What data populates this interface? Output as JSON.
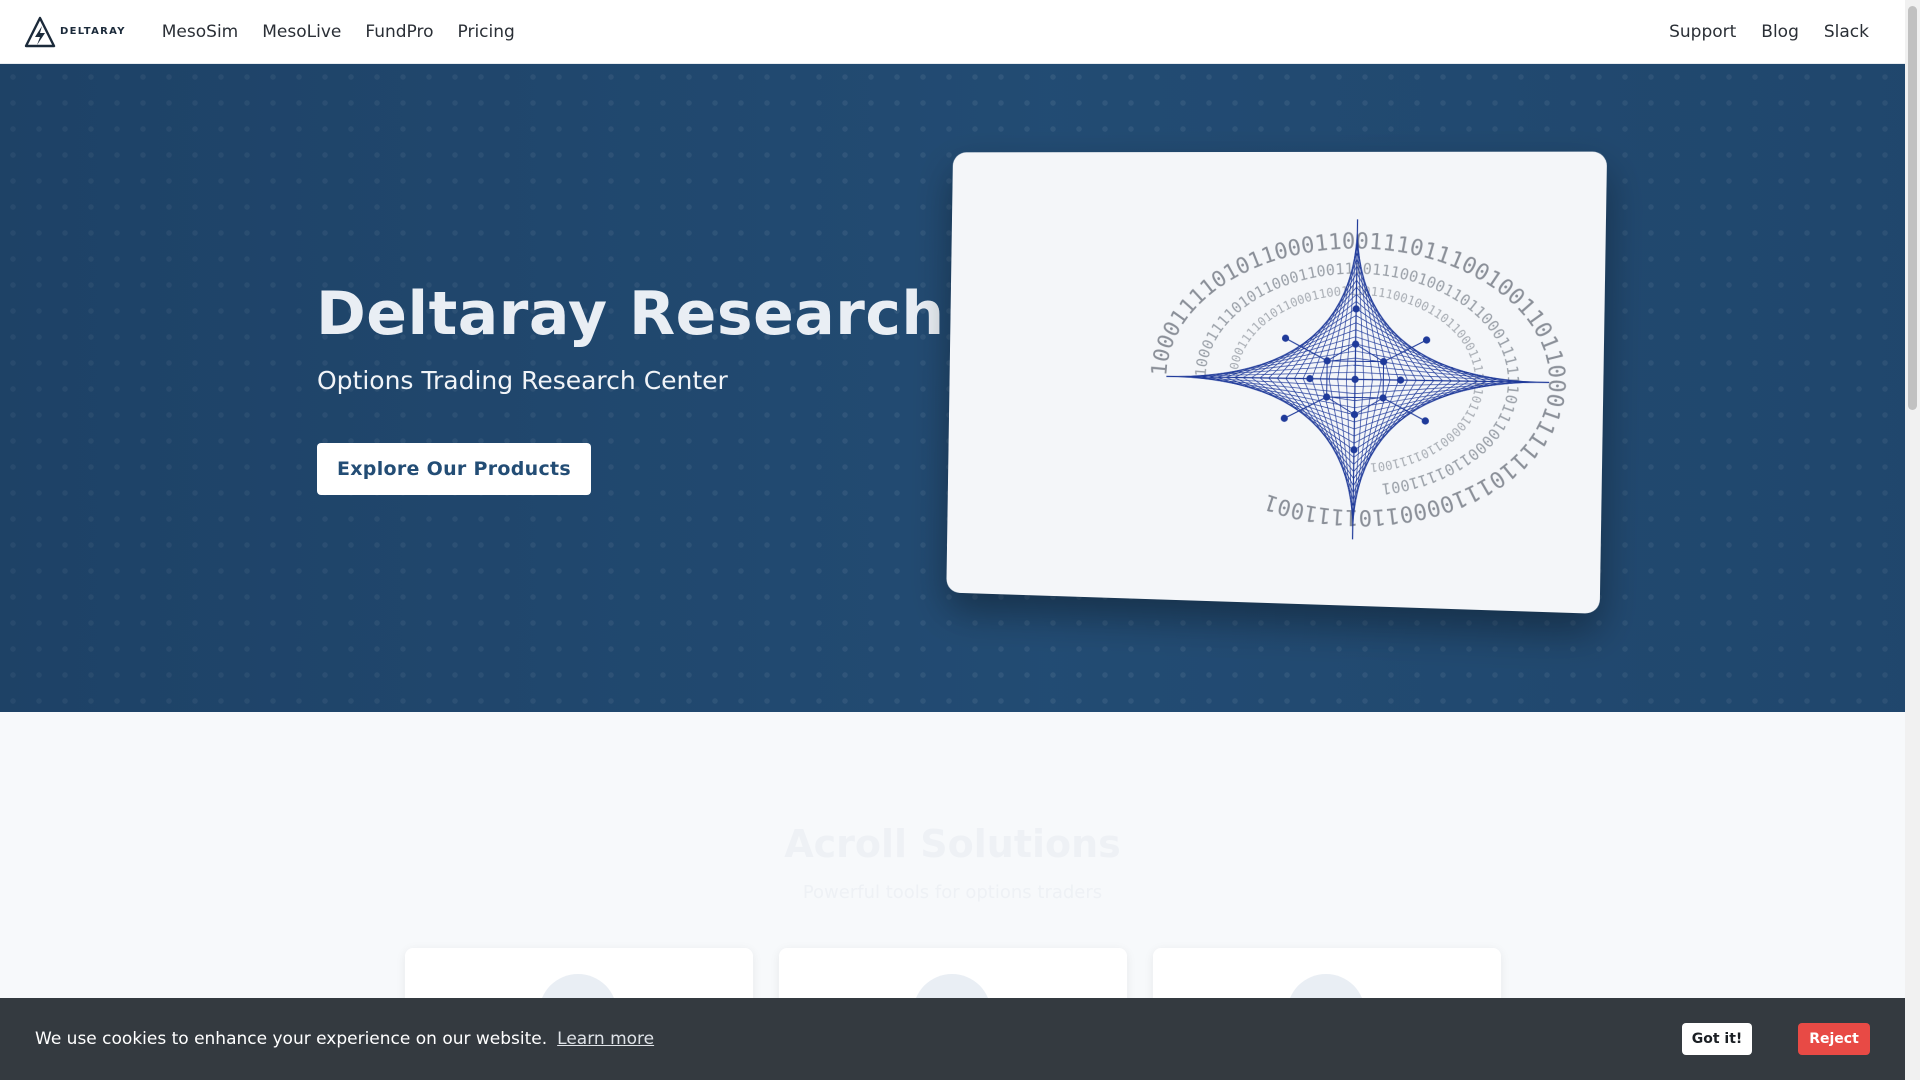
{
  "brand": {
    "name": "DELTARAY"
  },
  "nav": {
    "left": [
      "MesoSim",
      "MesoLive",
      "FundPro",
      "Pricing"
    ],
    "right": [
      "Support",
      "Blog",
      "Slack"
    ]
  },
  "hero": {
    "title": "Deltaray Research",
    "subtitle": "Options Trading Research Center",
    "cta": "Explore Our Products",
    "card_binary_text": "1000111101011000110011101110010011011000111111011100001101111001"
  },
  "solutions": {
    "title": "Acroll Solutions",
    "subtitle": "Powerful tools for options traders"
  },
  "cookie": {
    "message": "We use cookies to enhance your experience on our website.",
    "learn_more": "Learn more",
    "accept": "Got it!",
    "reject": "Reject"
  },
  "colors": {
    "hero_bg": "#234d75",
    "cookie_bg": "#343a40",
    "reject": "#e84a45",
    "star_blue": "#1f3a9a"
  },
  "icons": [
    "deltaray-logo-icon",
    "chart-icon",
    "star-icon",
    "monitor-icon"
  ]
}
